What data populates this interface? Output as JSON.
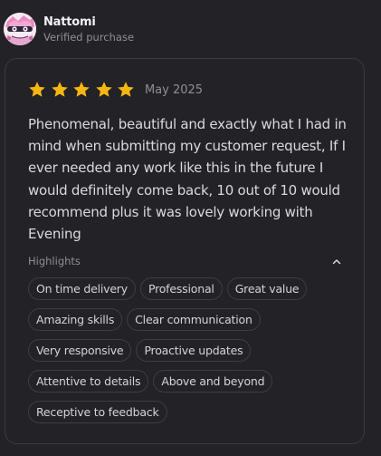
{
  "reviewer": {
    "name": "Nattomi",
    "subtitle": "Verified purchase"
  },
  "review": {
    "rating": 5,
    "rating_max": 5,
    "date": "May 2025",
    "text": "Phenomenal, beautiful and exactly what I had in mind when submitting my customer request, If I ever needed any work like this in the future I would definitely come back, 10 out of 10 would recommend plus it was lovely working with Evening"
  },
  "highlights": {
    "label": "Highlights",
    "rows": [
      [
        "On time delivery",
        "Professional",
        "Great value"
      ],
      [
        "Amazing skills",
        "Clear communication"
      ],
      [
        "Very responsive",
        "Proactive updates"
      ],
      [
        "Attentive to details",
        "Above and beyond"
      ],
      [
        "Receptive to feedback"
      ]
    ]
  },
  "colors": {
    "star": "#f5b70f",
    "background": "#222227",
    "card_border": "#3a3a41"
  },
  "icons": {
    "star": "star-icon",
    "collapse": "chevron-up-icon",
    "avatar": "avatar-illustration"
  }
}
